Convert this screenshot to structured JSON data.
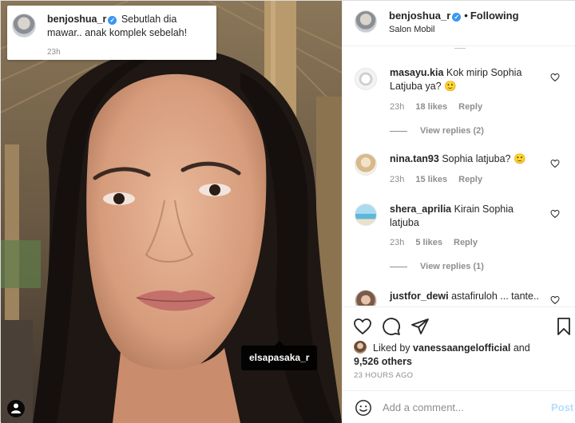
{
  "caption": {
    "username": "benjoshua_r",
    "text": "Sebutlah dia mawar.. anak komplek sebelah!",
    "time": "23h"
  },
  "photo_tag": {
    "username": "elsapasaka_r"
  },
  "header": {
    "username": "benjoshua_r",
    "follow_status": "Following",
    "location": "Salon Mobil"
  },
  "comments": [
    {
      "username": "masayu.kia",
      "text": "Kok mirip Sophia Latjuba ya? 🙂",
      "time": "23h",
      "likes": "18 likes",
      "reply": "Reply",
      "view_replies": "View replies (2)"
    },
    {
      "username": "nina.tan93",
      "text": "Sophia latjuba? 🙂",
      "time": "23h",
      "likes": "15 likes",
      "reply": "Reply"
    },
    {
      "username": "shera_aprilia",
      "text": "Kirain Sophia latjuba",
      "time": "23h",
      "likes": "5 likes",
      "reply": "Reply",
      "view_replies": "View replies (1)"
    },
    {
      "username": "justfor_dewi",
      "text": "astafiruloh ... tante.."
    }
  ],
  "likes": {
    "prefix": "Liked by",
    "liker": "vanessaangelofficial",
    "conjunction": "and",
    "others": "9,526 others"
  },
  "time_ago": "23 HOURS AGO",
  "comment_box": {
    "placeholder": "Add a comment...",
    "post_label": "Post"
  },
  "colors": {
    "accent": "#3897f0",
    "post_disabled": "#b2dffc",
    "muted": "#8e8e8e"
  },
  "icons": [
    "heart-icon",
    "comment-icon",
    "share-icon",
    "bookmark-icon",
    "emoji-icon",
    "user-tag-icon",
    "verified-icon"
  ]
}
